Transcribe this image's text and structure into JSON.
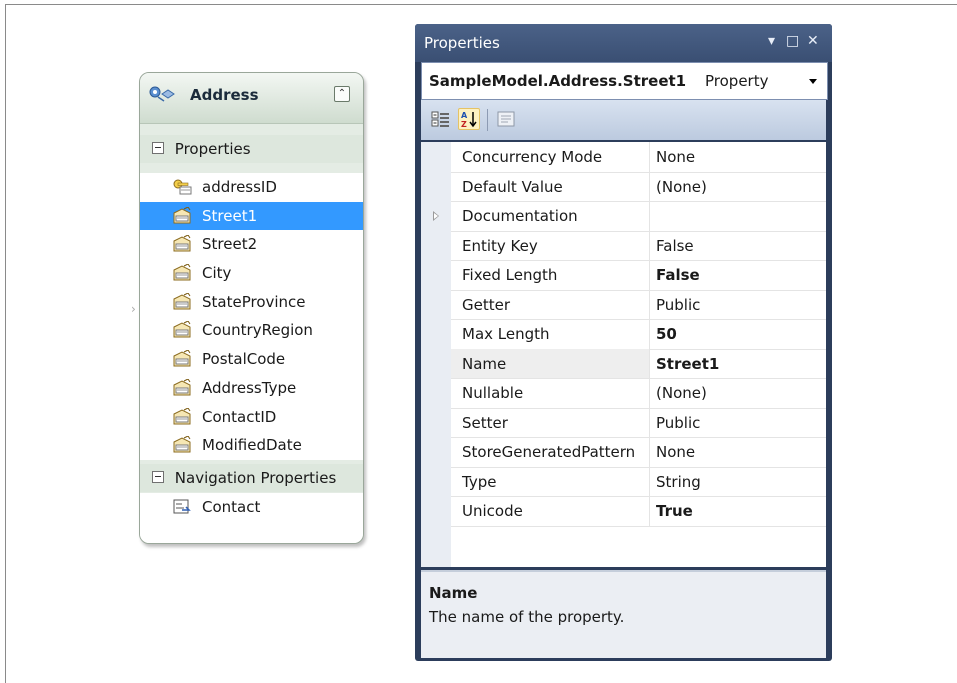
{
  "entity": {
    "title": "Address",
    "collapse_glyph": "⌃",
    "sections": {
      "properties_label": "Properties",
      "navigation_label": "Navigation Properties"
    },
    "properties": [
      {
        "name": "addressID",
        "icon": "key-property-icon",
        "selected": false
      },
      {
        "name": "Street1",
        "icon": "scalar-property-icon",
        "selected": true
      },
      {
        "name": "Street2",
        "icon": "scalar-property-icon",
        "selected": false
      },
      {
        "name": "City",
        "icon": "scalar-property-icon",
        "selected": false
      },
      {
        "name": "StateProvince",
        "icon": "scalar-property-icon",
        "selected": false
      },
      {
        "name": "CountryRegion",
        "icon": "scalar-property-icon",
        "selected": false
      },
      {
        "name": "PostalCode",
        "icon": "scalar-property-icon",
        "selected": false
      },
      {
        "name": "AddressType",
        "icon": "scalar-property-icon",
        "selected": false
      },
      {
        "name": "ContactID",
        "icon": "scalar-property-icon",
        "selected": false
      },
      {
        "name": "ModifiedDate",
        "icon": "scalar-property-icon",
        "selected": false
      }
    ],
    "navigation": [
      {
        "name": "Contact",
        "icon": "navigation-property-icon"
      }
    ]
  },
  "properties_window": {
    "title": "Properties",
    "buttons": {
      "pin": "▾",
      "maximize": "□",
      "close": "✕"
    },
    "object_name": "SampleModel.Address.Street1",
    "object_type": "Property",
    "toolbar": {
      "categorized_icon": "categorized-icon",
      "alphabetical_icon": "alphabetical-sort-icon",
      "property_pages_icon": "property-pages-icon"
    },
    "rows": [
      {
        "name": "Concurrency Mode",
        "value": "None",
        "bold": false,
        "expandable": false
      },
      {
        "name": "Default Value",
        "value": "(None)",
        "bold": false,
        "expandable": false
      },
      {
        "name": "Documentation",
        "value": "",
        "bold": false,
        "expandable": true
      },
      {
        "name": "Entity Key",
        "value": "False",
        "bold": false,
        "expandable": false
      },
      {
        "name": "Fixed Length",
        "value": "False",
        "bold": true,
        "expandable": false
      },
      {
        "name": "Getter",
        "value": "Public",
        "bold": false,
        "expandable": false
      },
      {
        "name": "Max Length",
        "value": "50",
        "bold": true,
        "expandable": false
      },
      {
        "name": "Name",
        "value": "Street1",
        "bold": true,
        "expandable": false,
        "selected": true
      },
      {
        "name": "Nullable",
        "value": "(None)",
        "bold": false,
        "expandable": false
      },
      {
        "name": "Setter",
        "value": "Public",
        "bold": false,
        "expandable": false
      },
      {
        "name": "StoreGeneratedPattern",
        "value": "None",
        "bold": false,
        "expandable": false
      },
      {
        "name": "Type",
        "value": "String",
        "bold": false,
        "expandable": false
      },
      {
        "name": "Unicode",
        "value": "True",
        "bold": true,
        "expandable": false
      }
    ],
    "description": {
      "title": "Name",
      "text": "The name of the property."
    }
  },
  "colors": {
    "selection": "#3399ff",
    "window_frame": "#2c3d5b",
    "entity_fill": "#e4ece4"
  }
}
